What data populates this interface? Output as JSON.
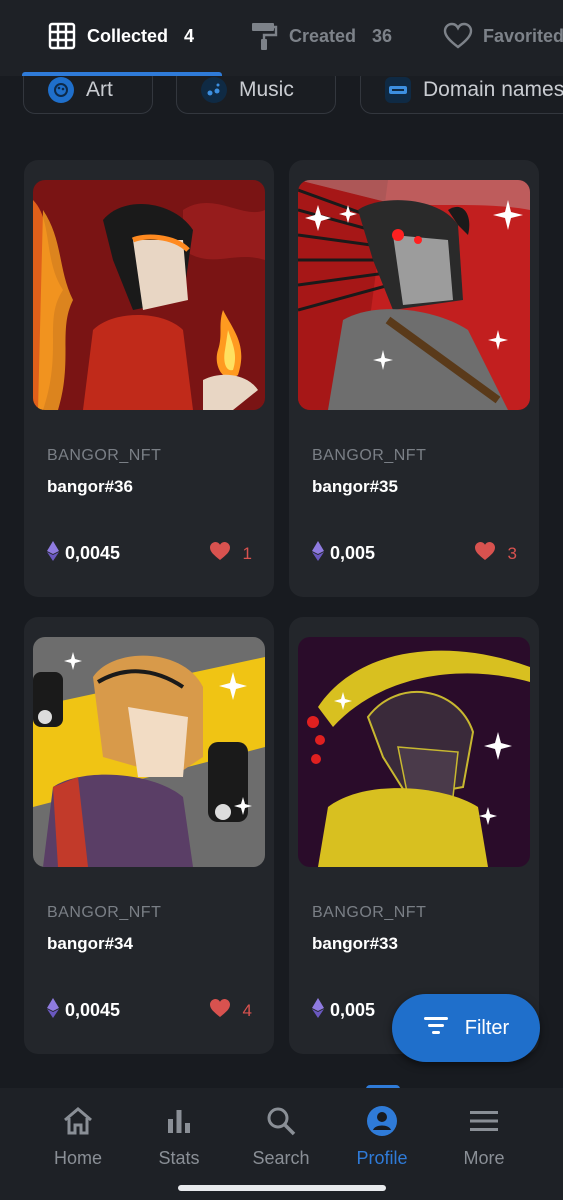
{
  "tabs": [
    {
      "label": "Collected",
      "count": "4",
      "icon": "grid-icon"
    },
    {
      "label": "Created",
      "count": "36",
      "icon": "paint-roller-icon"
    },
    {
      "label": "Favorited",
      "icon": "heart-outline-icon"
    }
  ],
  "categories": [
    {
      "label": "Art",
      "icon": "art-icon"
    },
    {
      "label": "Music",
      "icon": "music-icon"
    },
    {
      "label": "Domain names",
      "icon": "domain-icon"
    }
  ],
  "items": [
    {
      "collection": "BANGOR_NFT",
      "name": "bangor#36",
      "price": "0,0045",
      "likes": "1"
    },
    {
      "collection": "BANGOR_NFT",
      "name": "bangor#35",
      "price": "0,005",
      "likes": "3"
    },
    {
      "collection": "BANGOR_NFT",
      "name": "bangor#34",
      "price": "0,0045",
      "likes": "4"
    },
    {
      "collection": "BANGOR_NFT",
      "name": "bangor#33",
      "price": "0,005"
    }
  ],
  "filter_button": {
    "label": "Filter"
  },
  "nav": [
    {
      "label": "Home",
      "icon": "home-icon"
    },
    {
      "label": "Stats",
      "icon": "stats-icon"
    },
    {
      "label": "Search",
      "icon": "search-icon"
    },
    {
      "label": "Profile",
      "icon": "profile-icon"
    },
    {
      "label": "More",
      "icon": "menu-icon"
    }
  ],
  "colors": {
    "accent": "#2f7bd8",
    "like": "#d8524f",
    "eth": "#8f7be0",
    "background": "#181b20",
    "card": "#23262b"
  }
}
